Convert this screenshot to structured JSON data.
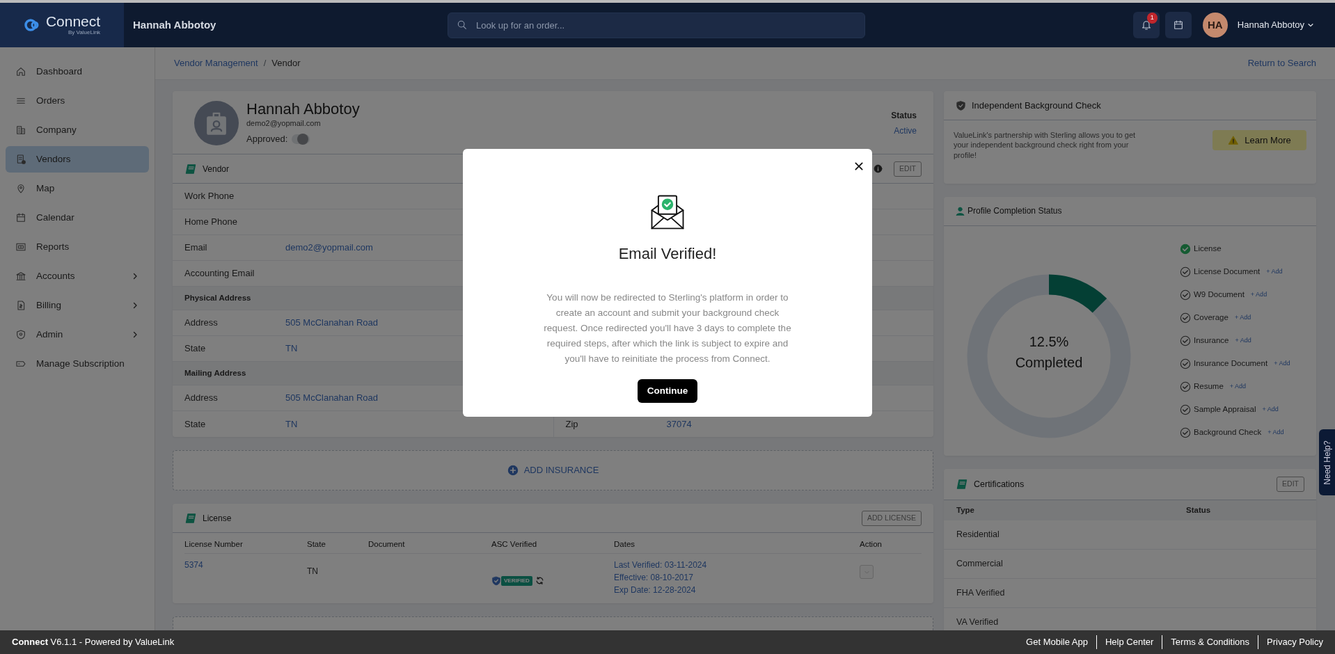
{
  "topbar": {
    "brand": "Connect",
    "brand_sub": "By ValueLink",
    "page_title": "Hannah Abbotoy",
    "search": {
      "placeholder": "Look up for an order..."
    },
    "notification_count": "1",
    "user": {
      "initials": "HA",
      "name": "Hannah Abbotoy"
    }
  },
  "sidebar": {
    "items": [
      {
        "label": "Dashboard",
        "kind": "home",
        "selected": false,
        "expandable": false
      },
      {
        "label": "Orders",
        "kind": "list",
        "selected": false,
        "expandable": false
      },
      {
        "label": "Company",
        "kind": "building",
        "selected": false,
        "expandable": false
      },
      {
        "label": "Vendors",
        "kind": "vendor",
        "selected": true,
        "expandable": false
      },
      {
        "label": "Map",
        "kind": "pin",
        "selected": false,
        "expandable": false
      },
      {
        "label": "Calendar",
        "kind": "calendar",
        "selected": false,
        "expandable": false
      },
      {
        "label": "Reports",
        "kind": "report",
        "selected": false,
        "expandable": false
      },
      {
        "label": "Accounts",
        "kind": "bank",
        "selected": false,
        "expandable": true
      },
      {
        "label": "Billing",
        "kind": "bill",
        "selected": false,
        "expandable": true
      },
      {
        "label": "Admin",
        "kind": "shield",
        "selected": false,
        "expandable": true
      },
      {
        "label": "Manage Subscription",
        "kind": "tag",
        "selected": false,
        "expandable": false
      }
    ]
  },
  "breadcrumb": {
    "items": [
      "Vendor Management",
      "Vendor"
    ],
    "separator": "/"
  },
  "return_link": "Return to Search",
  "profile": {
    "name": "Hannah Abbotoy",
    "email": "demo2@yopmail.com",
    "approved_label": "Approved:",
    "approved": {
      "on": false
    },
    "status_label": "Status",
    "status": "Active"
  },
  "vendor_card": {
    "title": "Vendor",
    "edit": "EDIT",
    "rows": [
      {
        "kind": "field",
        "label": "Work Phone"
      },
      {
        "kind": "field",
        "label": "Home Phone"
      },
      {
        "kind": "field",
        "label": "Email",
        "value": "demo2@yopmail.com"
      },
      {
        "kind": "field",
        "label": "Accounting Email"
      },
      {
        "kind": "section",
        "label": "Physical Address"
      },
      {
        "kind": "field",
        "label": "Address",
        "value": "505 McClanahan Road"
      },
      {
        "kind": "field",
        "label": "State",
        "value": "TN"
      },
      {
        "kind": "section",
        "label": "Mailing Address"
      },
      {
        "kind": "field",
        "label": "Address",
        "value": "505 McClanahan Road"
      },
      {
        "kind": "field",
        "label": "State",
        "value": "TN",
        "right_label": "Zip",
        "right_value": "37074"
      }
    ]
  },
  "add_insurance": "ADD INSURANCE",
  "license_card": {
    "title": "License",
    "button": "ADD LICENSE",
    "columns": [
      "License Number",
      "State",
      "Document",
      "ASC Verified",
      "Dates",
      "Action"
    ],
    "rows": [
      {
        "number": "5374",
        "state": "TN",
        "asc": {
          "verified": true,
          "badge": "VERIFIED"
        },
        "dates": [
          "Last Verified: 03-11-2024",
          "Effective: 08-10-2017",
          "Exp Date: 12-28-2024"
        ]
      }
    ]
  },
  "background_check": {
    "title": "Independent Background Check",
    "text": "ValueLink's partnership with Sterling allows you to get your independent background check right from your profile!",
    "button": "Learn More"
  },
  "completion": {
    "title": "Profile Completion Status",
    "level": 0.125,
    "percent": "12.5%",
    "caption": "Completed",
    "items": [
      {
        "label": "License",
        "checked": true
      },
      {
        "label": "License Document",
        "checked": false,
        "add": "+ Add"
      },
      {
        "label": "W9 Document",
        "checked": false,
        "add": "+ Add"
      },
      {
        "label": "Coverage",
        "checked": false,
        "add": "+ Add"
      },
      {
        "label": "Insurance",
        "checked": false,
        "add": "+ Add"
      },
      {
        "label": "Insurance Document",
        "checked": false,
        "add": "+ Add"
      },
      {
        "label": "Resume",
        "checked": false,
        "add": "+ Add"
      },
      {
        "label": "Sample Appraisal",
        "checked": false,
        "add": "+ Add"
      },
      {
        "label": "Background Check",
        "checked": false,
        "add": "+ Add"
      }
    ]
  },
  "certifications": {
    "title": "Certifications",
    "edit": "EDIT",
    "columns": [
      "Type",
      "Status"
    ],
    "rows": [
      "Residential",
      "Commercial",
      "FHA Verified",
      "VA Verified"
    ]
  },
  "need_help": "Need Help?",
  "modal": {
    "title": "Email Verified!",
    "body": "You will now be redirected to Sterling's platform in order to create an account and submit your background check request. Once redirected you'll have 3 days to complete the required steps, after which the link is subject to expire and you'll have to reinitiate the process from Connect.",
    "button": "Continue"
  },
  "footer": {
    "text": "**Connect** V6.1.1 - Powered by ValueLink",
    "links": [
      "Get Mobile App",
      "Help Center",
      "Terms & Conditions",
      "Privacy Policy"
    ]
  }
}
